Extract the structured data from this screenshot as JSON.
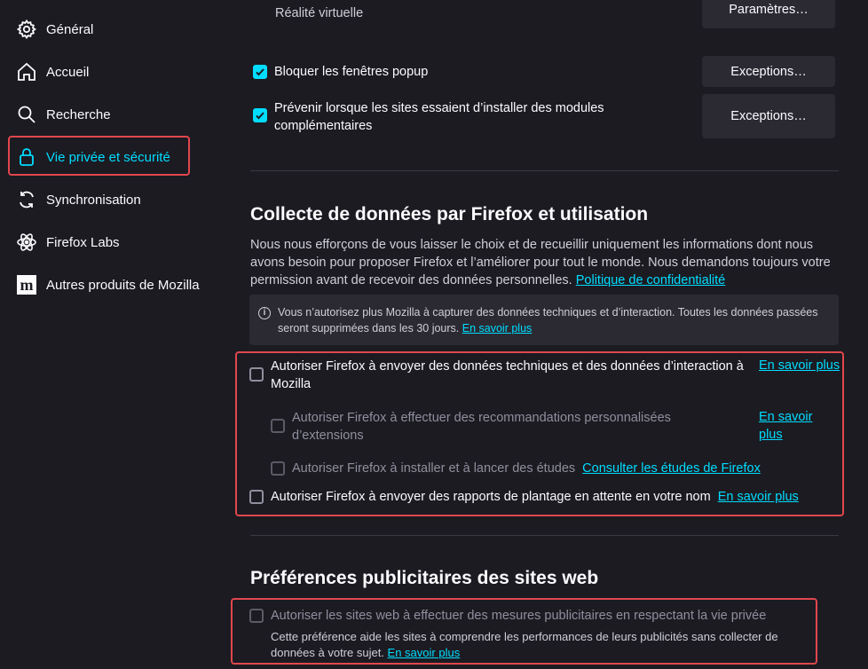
{
  "sidebar": {
    "items": [
      {
        "label": "Général",
        "icon": "gear-icon"
      },
      {
        "label": "Accueil",
        "icon": "home-icon"
      },
      {
        "label": "Recherche",
        "icon": "search-icon"
      },
      {
        "label": "Vie privée et sécurité",
        "icon": "lock-icon",
        "active": true
      },
      {
        "label": "Synchronisation",
        "icon": "sync-icon"
      },
      {
        "label": "Firefox Labs",
        "icon": "atom-icon"
      },
      {
        "label": "Autres produits de Mozilla",
        "icon": "mozilla-logo-icon"
      }
    ]
  },
  "top": {
    "cut_text": "Réalité virtuelle",
    "cut_button": "Paramètres…"
  },
  "permissions": {
    "popup_label": "Bloquer les fenêtres popup",
    "popup_checked": true,
    "popup_button": "Exceptions…",
    "addons_label": "Prévenir lorsque les sites essaient d’installer des modules complémentaires",
    "addons_checked": true,
    "addons_button": "Exceptions…"
  },
  "data_collection": {
    "title": "Collecte de données par Firefox et utilisation",
    "description": "Nous nous efforçons de vous laisser le choix et de recueillir uniquement les informations dont nous avons besoin pour proposer Firefox et l’améliorer pour tout le monde. Nous demandons toujours votre permission avant de recevoir des données personnelles.",
    "privacy_link": "Politique de confidentialité",
    "info_text": "Vous n’autorisez plus Mozilla à capturer des données techniques et d’interaction. Toutes les données passées seront supprimées dans les 30 jours.",
    "info_link": "En savoir plus",
    "telemetry_label": "Autoriser Firefox à envoyer des données techniques et des données d’interaction à Mozilla",
    "telemetry_link": "En savoir plus",
    "recommend_label": "Autoriser Firefox à effectuer des recommandations personnalisées d’extensions",
    "recommend_link": "En savoir plus",
    "studies_label": "Autoriser Firefox à installer et à lancer des études",
    "studies_link": "Consulter les études de Firefox",
    "crash_label": "Autoriser Firefox à envoyer des rapports de plantage en attente en votre nom",
    "crash_link": "En savoir plus"
  },
  "ads": {
    "title": "Préférences publicitaires des sites web",
    "label": "Autoriser les sites web à effectuer des mesures publicitaires en respectant la vie privée",
    "description": "Cette préférence aide les sites à comprendre les performances de leurs publicités sans collecter de données à votre sujet.",
    "link": "En savoir plus"
  },
  "colors": {
    "accent": "#00ddff",
    "background": "#1c1b22",
    "highlight_border": "#e0474d"
  }
}
